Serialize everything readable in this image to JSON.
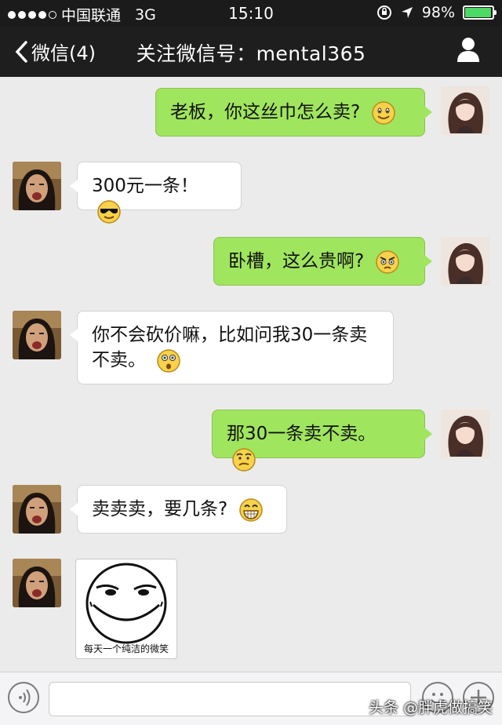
{
  "status_bar": {
    "carrier": "中国联通",
    "network": "3G",
    "time": "15:10",
    "battery": "98%",
    "battery_level": 0.98
  },
  "nav": {
    "back_label": "微信(4)",
    "title": "关注微信号：mental365"
  },
  "messages": [
    {
      "sender": "me",
      "text": "老板，你这丝巾怎么卖?",
      "emoji": "smile-emoji"
    },
    {
      "sender": "boss",
      "text": "300元一条！",
      "emoji": "sunglasses-emoji"
    },
    {
      "sender": "me",
      "text": "卧槽，这么贵啊?",
      "emoji": "angry-emoji"
    },
    {
      "sender": "boss",
      "line1": "你不会砍价嘛，比如问我30一条卖",
      "line2": "不卖。",
      "emoji": "surprised-emoji"
    },
    {
      "sender": "me",
      "text": "那30一条卖不卖。",
      "emoji": "confused-emoji"
    },
    {
      "sender": "boss",
      "text": "卖卖卖，要几条?",
      "emoji": "grin-emoji"
    },
    {
      "sender": "boss",
      "sticker_caption": "每天一个纯洁的微笑"
    }
  ],
  "watermark": "头条 @胖虎做搞笑",
  "colors": {
    "accent_green": "#a0e55e",
    "battery_green": "#4cd964",
    "bar_dark": "#1e1e1e"
  }
}
